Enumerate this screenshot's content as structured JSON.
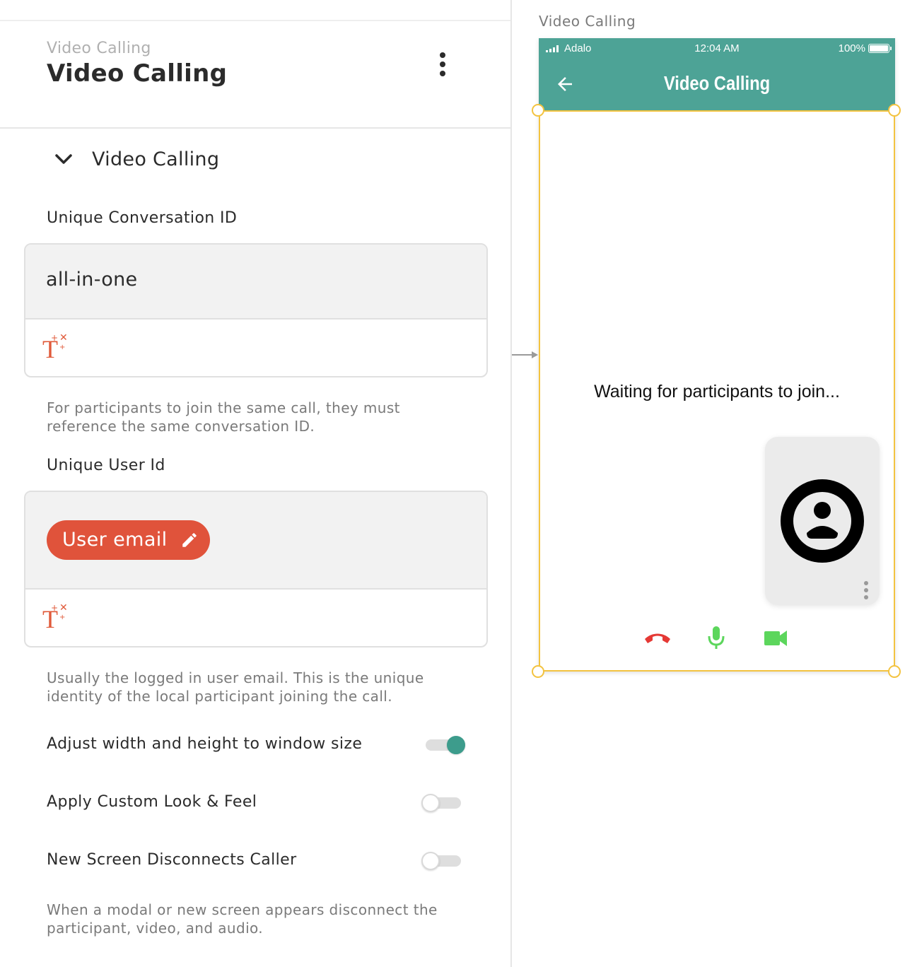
{
  "panel": {
    "component_type": "Video Calling",
    "component_name": "Video Calling",
    "section_title": "Video Calling",
    "conversation": {
      "label": "Unique Conversation ID",
      "value": "all-in-one",
      "help": "For participants to join the same call, they must reference the same conversation ID."
    },
    "user": {
      "label": "Unique User Id",
      "chip_label": "User email",
      "help": "Usually the logged in user email. This is the unique identity of the local participant joining the call."
    },
    "toggles": [
      {
        "label": "Adjust width and height to window size",
        "on": true
      },
      {
        "label": "Apply Custom Look & Feel",
        "on": false
      },
      {
        "label": "New Screen Disconnects Caller",
        "on": false
      }
    ],
    "disconnect_help": "When a modal or new screen appears disconnect the participant, video, and audio."
  },
  "canvas": {
    "screen_label": "Video Calling",
    "status": {
      "carrier": "Adalo",
      "time": "12:04 AM",
      "battery": "100%"
    },
    "appbar_title": "Video Calling",
    "waiting_text": "Waiting for participants to join..."
  },
  "icons": {
    "kebab": "more-vertical-icon",
    "chevron": "chevron-down-icon",
    "magic_text": "magic-text-icon",
    "pencil": "pencil-icon",
    "back": "arrow-left-icon",
    "avatar": "account-circle-icon",
    "hangup": "call-end-icon",
    "mic": "microphone-icon",
    "camera": "videocam-icon"
  },
  "colors": {
    "accent_teal": "#4da396",
    "switch_on": "#3d9c8c",
    "chip_red": "#e0533b",
    "selection_yellow": "#f3c340",
    "hangup_red": "#e53935",
    "control_green": "#5cd65c"
  }
}
